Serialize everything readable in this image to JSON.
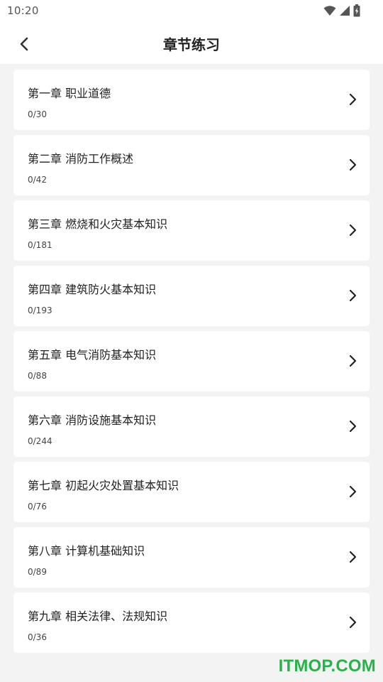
{
  "status_bar": {
    "time": "10:20",
    "icons": [
      "wifi-icon",
      "signal-icon",
      "battery-icon"
    ]
  },
  "header": {
    "title": "章节练习",
    "back_icon": "chevron-left-icon"
  },
  "chapters": [
    {
      "title": "第一章 职业道德",
      "progress": "0/30"
    },
    {
      "title": "第二章 消防工作概述",
      "progress": "0/42"
    },
    {
      "title": "第三章 燃烧和火灾基本知识",
      "progress": "0/181"
    },
    {
      "title": "第四章 建筑防火基本知识",
      "progress": "0/193"
    },
    {
      "title": "第五章 电气消防基本知识",
      "progress": "0/88"
    },
    {
      "title": "第六章 消防设施基本知识",
      "progress": "0/244"
    },
    {
      "title": "第七章 初起火灾处置基本知识",
      "progress": "0/76"
    },
    {
      "title": "第八章 计算机基础知识",
      "progress": "0/89"
    },
    {
      "title": "第九章 相关法律、法规知识",
      "progress": "0/36"
    }
  ],
  "watermark": "ITMOP.COM",
  "colors": {
    "background": "#f3f3f3",
    "card": "#ffffff",
    "watermark": "#27b34a"
  }
}
